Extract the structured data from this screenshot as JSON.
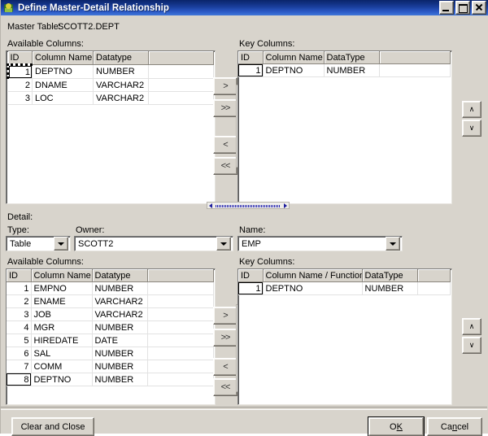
{
  "window": {
    "title": "Define Master-Detail Relationship",
    "icon": "app-icon",
    "controls": {
      "minimize": "minimize-button",
      "maximize": "maximize-button",
      "close": "close-button"
    }
  },
  "master": {
    "label": "Master Table:",
    "value": "SCOTT2.DEPT",
    "available": {
      "label": "Available Columns:",
      "headers": [
        "ID",
        "Column Name",
        "Datatype"
      ],
      "rows": [
        {
          "id": "1",
          "name": "DEPTNO",
          "type": "NUMBER"
        },
        {
          "id": "2",
          "name": "DNAME",
          "type": "VARCHAR2"
        },
        {
          "id": "3",
          "name": "LOC",
          "type": "VARCHAR2"
        }
      ]
    },
    "key": {
      "label": "Key Columns:",
      "headers": [
        "ID",
        "Column Name",
        "DataType"
      ],
      "rows": [
        {
          "id": "1",
          "name": "DEPTNO",
          "type": "NUMBER"
        }
      ]
    },
    "transfer": {
      "add": ">",
      "add_all": ">>",
      "remove": "<",
      "remove_all": "<<"
    },
    "reorder": {
      "up": "∧",
      "down": "∨"
    }
  },
  "detail": {
    "label": "Detail:",
    "type": {
      "label": "Type:",
      "value": "Table"
    },
    "owner": {
      "label": "Owner:",
      "value": "SCOTT2"
    },
    "name": {
      "label": "Name:",
      "value": "EMP"
    },
    "available": {
      "label": "Available Columns:",
      "headers": [
        "ID",
        "Column Name",
        "Datatype"
      ],
      "rows": [
        {
          "id": "1",
          "name": "EMPNO",
          "type": "NUMBER"
        },
        {
          "id": "2",
          "name": "ENAME",
          "type": "VARCHAR2"
        },
        {
          "id": "3",
          "name": "JOB",
          "type": "VARCHAR2"
        },
        {
          "id": "4",
          "name": "MGR",
          "type": "NUMBER"
        },
        {
          "id": "5",
          "name": "HIREDATE",
          "type": "DATE"
        },
        {
          "id": "6",
          "name": "SAL",
          "type": "NUMBER"
        },
        {
          "id": "7",
          "name": "COMM",
          "type": "NUMBER"
        },
        {
          "id": "8",
          "name": "DEPTNO",
          "type": "NUMBER"
        }
      ]
    },
    "key": {
      "label": "Key Columns:",
      "headers": [
        "ID",
        "Column Name / Function",
        "DataType"
      ],
      "rows": [
        {
          "id": "1",
          "name": "DEPTNO",
          "type": "NUMBER"
        }
      ]
    },
    "transfer": {
      "add": ">",
      "add_all": ">>",
      "remove": "<",
      "remove_all": "<<"
    },
    "reorder": {
      "up": "∧",
      "down": "∨"
    }
  },
  "footer": {
    "clear_and_close": "Clear and Close",
    "ok": "OK",
    "cancel": "Cancel"
  },
  "colors": {
    "title_start": "#0a246a",
    "title_end": "#3f76d8",
    "face": "#d8d4cc",
    "field": "#ffffff",
    "scroll_accent": "#2020b0"
  }
}
